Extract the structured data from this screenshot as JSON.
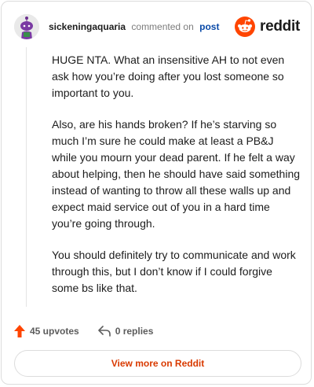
{
  "comment": {
    "username": "sickeningaquaria",
    "action": "commented on",
    "post_link": "post",
    "paragraphs": [
      "HUGE NTA. What an insensitive AH to not even ask how you’re doing after you lost someone so important to you.",
      "Also, are his hands broken? If he’s starving so much I’m sure he could make at least a PB&J while you mourn your dead parent. If he felt a way about helping, then he should have said something instead of wanting to throw all these walls up and expect maid service out of you in a hard time you’re going through.",
      "You should definitely try to communicate and work through this, but I don’t know if I could forgive some bs like that."
    ]
  },
  "brand": {
    "name": "reddit",
    "color": "#ff4500"
  },
  "stats": {
    "upvotes": "45 upvotes",
    "replies": "0 replies"
  },
  "cta": {
    "label": "View more on Reddit"
  },
  "icons": {
    "upvote": "upvote-arrow-icon",
    "reply": "reply-arrow-icon",
    "logo": "reddit-alien-icon"
  },
  "colors": {
    "upvote": "#ff4500",
    "link": "#0a4aa8",
    "cta_text": "#d93a00"
  }
}
